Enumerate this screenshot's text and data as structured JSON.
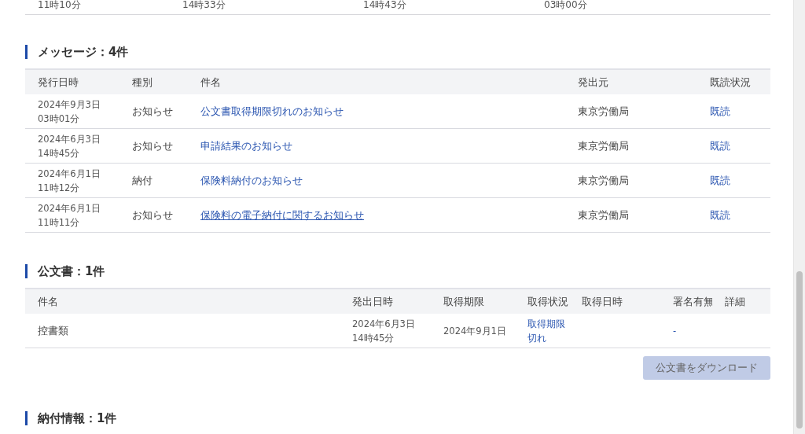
{
  "previous_row": [
    "11時10分",
    "14時33分",
    "14時43分",
    "03時00分"
  ],
  "messages": {
    "heading": "メッセージ：4件",
    "columns": [
      "発行日時",
      "種別",
      "件名",
      "発出元",
      "既読状況"
    ],
    "rows": [
      {
        "date": "2024年9月3日",
        "time": "03時01分",
        "type": "お知らせ",
        "subject": "公文書取得期限切れのお知らせ",
        "hovered": false,
        "sender": "東京労働局",
        "status": "既読"
      },
      {
        "date": "2024年6月3日",
        "time": "14時45分",
        "type": "お知らせ",
        "subject": "申請結果のお知らせ",
        "hovered": false,
        "sender": "東京労働局",
        "status": "既読"
      },
      {
        "date": "2024年6月1日",
        "time": "11時12分",
        "type": "納付",
        "subject": "保険料納付のお知らせ",
        "hovered": false,
        "sender": "東京労働局",
        "status": "既読"
      },
      {
        "date": "2024年6月1日",
        "time": "11時11分",
        "type": "お知らせ",
        "subject": "保険料の電子納付に関するお知らせ",
        "hovered": true,
        "sender": "東京労働局",
        "status": "既読"
      }
    ]
  },
  "documents": {
    "heading": "公文書：1件",
    "columns": [
      "件名",
      "発出日時",
      "取得期限",
      "取得状況",
      "取得日時",
      "署名有無",
      "詳細"
    ],
    "rows": [
      {
        "subject": "控書類",
        "date": "2024年6月3日",
        "time": "14時45分",
        "deadline": "2024年9月1日",
        "status_line_1": "取得期限",
        "status_line_2": "切れ",
        "signature": "-"
      }
    ],
    "download_button": {
      "label": "公文書をダウンロード",
      "disabled": true
    }
  },
  "payment": {
    "heading": "納付情報：1件"
  }
}
